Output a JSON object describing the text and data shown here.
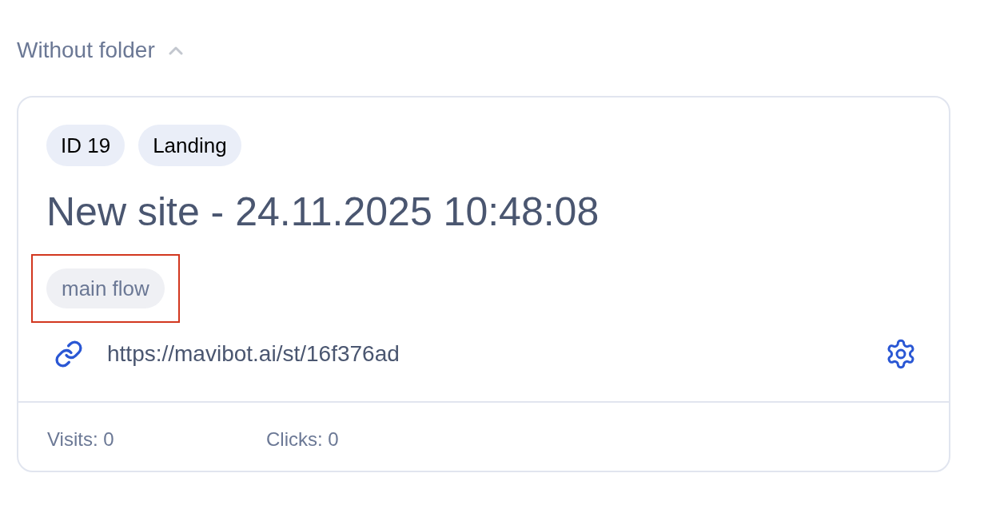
{
  "folder": {
    "title": "Without folder",
    "expanded": true
  },
  "card": {
    "badges": [
      "ID 19",
      "Landing"
    ],
    "title": "New site - 24.11.2025 10:48:08",
    "tags": [
      {
        "label": "main flow",
        "highlighted": true
      }
    ],
    "url": "https://mavibot.ai/st/16f376ad",
    "stats": [
      "Visits: 0",
      "Clicks: 0"
    ]
  }
}
